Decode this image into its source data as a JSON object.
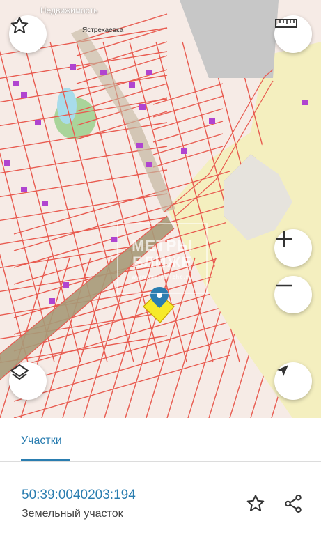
{
  "map": {
    "top_label": "Недвижимость",
    "place_label": "Ястрехаевка",
    "watermark": {
      "line1": "МЕТРЫ",
      "line2": "БЛИЖЕ",
      "line3": "www.metrblizhe.ru"
    },
    "buttons": {
      "favorite": "star-icon",
      "ruler": "ruler-icon",
      "zoom_in": "plus-icon",
      "zoom_out": "minus-icon",
      "layers": "layers-icon",
      "locate": "navigation-arrow-icon"
    },
    "colors": {
      "parcel_fill": "#f6ebe6",
      "parcel_line": "#e85a4f",
      "road": "#a79a78",
      "yellow_zone": "#f4efbf",
      "building": "#e6dfdc",
      "water": "#a8dceb",
      "park": "#a9d49a",
      "structure": "#b044d0",
      "selected_fill": "#f6ea29",
      "pin": "#2a7db0"
    }
  },
  "sheet": {
    "tab_label": "Участки",
    "cadastral_number": "50:39:0040203:194",
    "object_type": "Земельный участок",
    "actions": {
      "favorite": "star-outline-icon",
      "share": "share-icon"
    }
  }
}
